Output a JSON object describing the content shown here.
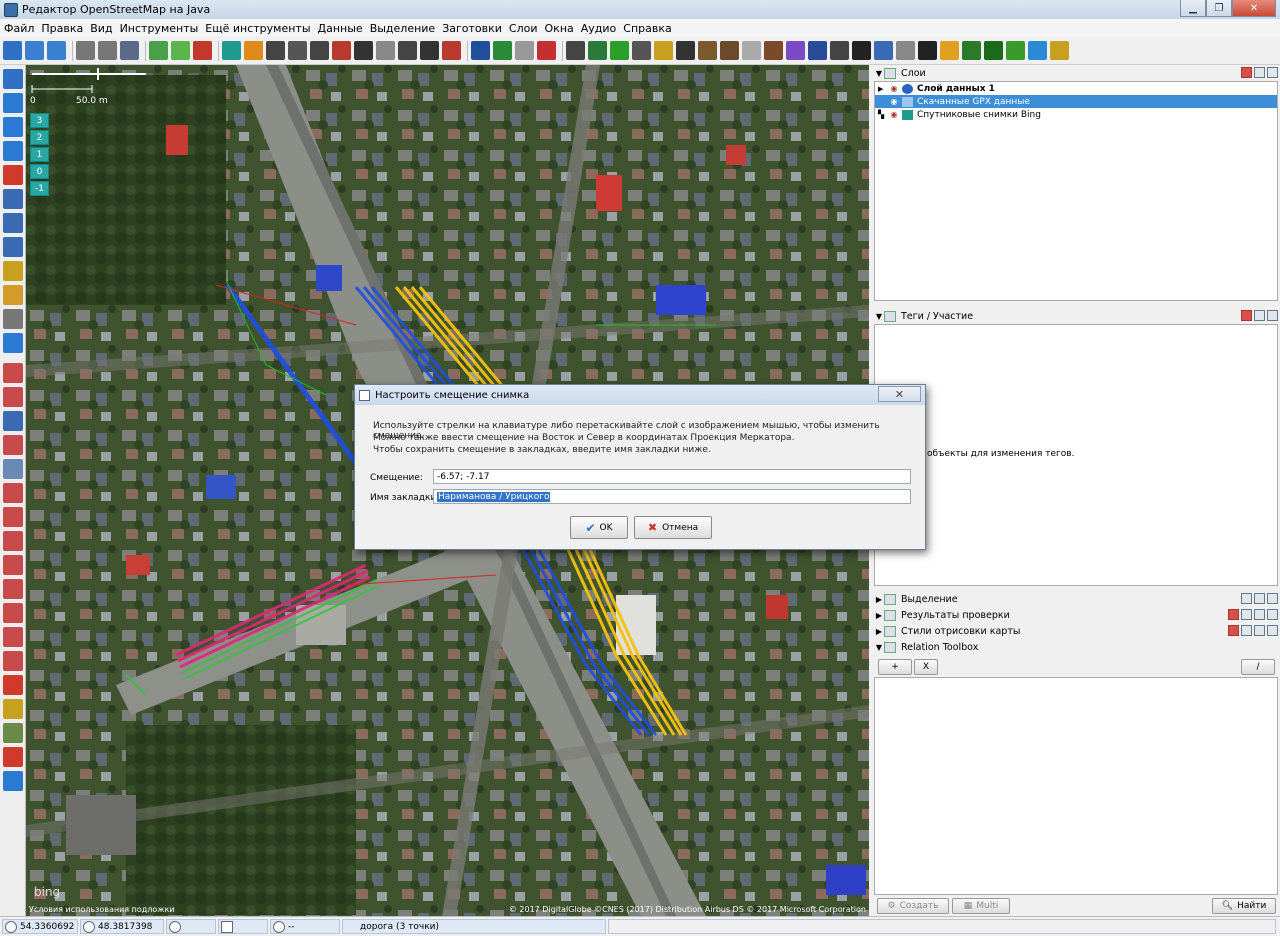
{
  "window": {
    "title": "Редактор OpenStreetMap на Java",
    "minimize_glyph": "▁",
    "maximize_glyph": "❐",
    "close_glyph": "✕"
  },
  "menu": [
    "Файл",
    "Правка",
    "Вид",
    "Инструменты",
    "Ещё инструменты",
    "Данные",
    "Выделение",
    "Заготовки",
    "Слои",
    "Окна",
    "Аудио",
    "Справка"
  ],
  "toolbar": {
    "icons": [
      "open-file",
      "download",
      "upload",
      "undo",
      "redo",
      "preferences",
      "download-along",
      "update-data",
      "update-modified",
      "bing",
      "traffic-light",
      "barrier",
      "street-lamp",
      "railway",
      "bridge",
      "building",
      "wall",
      "crossing",
      "tunnel",
      "car",
      "info",
      "globe",
      "grey-circle",
      "flag",
      "theatre",
      "picture",
      "first-aid",
      "dentist",
      "balloons",
      "telephone",
      "ruins",
      "factory",
      "church",
      "restaurant",
      "shop",
      "clothes",
      "sofa",
      "money",
      "pharmacy",
      "paperclip",
      "person",
      "bag",
      "tree",
      "forest",
      "grass",
      "water",
      "wheat"
    ]
  },
  "left_tools": [
    "select",
    "lasso",
    "draw",
    "zoom",
    "delete",
    "split",
    "combine",
    "split-way",
    "edit",
    "draw-line",
    "building-tool",
    "play",
    "layer-1",
    "layer-2",
    "layer-3",
    "layer-4",
    "layer-5",
    "layer-6",
    "layer-7",
    "layer-8",
    "layer-9",
    "layer-10",
    "layer-11",
    "layer-12",
    "layer-13",
    "location-pin",
    "image-offset",
    "person-tool",
    "speed-tool",
    "play-2"
  ],
  "map": {
    "scale_start": "0",
    "scale_end": "50.0 m",
    "zoom_levels": [
      "3",
      "2",
      "1",
      "0",
      "-1"
    ],
    "watermark": "bing",
    "terms_link": "Условия использования подложки",
    "copyright": "© 2017 DigitalGlobe ©CNES (2017) Distribution Airbus DS © 2017 Microsoft Corporation"
  },
  "panels": {
    "layers": {
      "title": "Слои",
      "items": [
        {
          "label": "Слой данных 1",
          "bold": true,
          "selected": false
        },
        {
          "label": "Скачанные GPX данные",
          "bold": false,
          "selected": true
        },
        {
          "label": "Спутниковые снимки Bing",
          "bold": false,
          "selected": false
        }
      ]
    },
    "tags": {
      "title": "Теги / Участие",
      "empty_hint": "объекты для изменения тегов."
    },
    "selection": {
      "title": "Выделение"
    },
    "validation": {
      "title": "Результаты проверки"
    },
    "map_styles": {
      "title": "Стили отрисовки карты"
    },
    "relation_toolbox": {
      "title": "Relation Toolbox",
      "add_glyph": "+",
      "clear_glyph": "X",
      "edit_glyph": "/"
    }
  },
  "bottom_buttons": {
    "create": "Создать",
    "multi": "Multi",
    "find": "Найти"
  },
  "statusbar": {
    "lat": "54.3360692",
    "lon": "48.3817398",
    "heading": "",
    "angle": "",
    "distance": "--",
    "info": "дорога (3 точки)"
  },
  "dialog": {
    "title": "Настроить смещение снимка",
    "close_glyph": "✕",
    "lines": [
      "Используйте стрелки на клавиатуре либо перетаскивайте слой с изображением мышью, чтобы изменить смещение.",
      "Можно также ввести смещение на Восток и Север в координатах Проекция Меркатора.",
      "Чтобы сохранить смещение в закладках, введите имя закладки ниже."
    ],
    "offset_label": "Смещение:",
    "offset_value": "-6.57; -7.17",
    "bookmark_label": "Имя закладки:",
    "bookmark_value": "Нариманова / Урицкого",
    "ok_label": "OK",
    "cancel_label": "Отмена",
    "ok_glyph": "✔",
    "cancel_glyph": "✖"
  },
  "colors": {
    "gpx_blue": "#1f4fe0",
    "gpx_yellow": "#f4c20d",
    "gpx_magenta": "#e0267a",
    "gpx_green": "#33c43a",
    "selection_blue": "#3c8ed8",
    "zoom_teal": "#2aa7a2"
  }
}
